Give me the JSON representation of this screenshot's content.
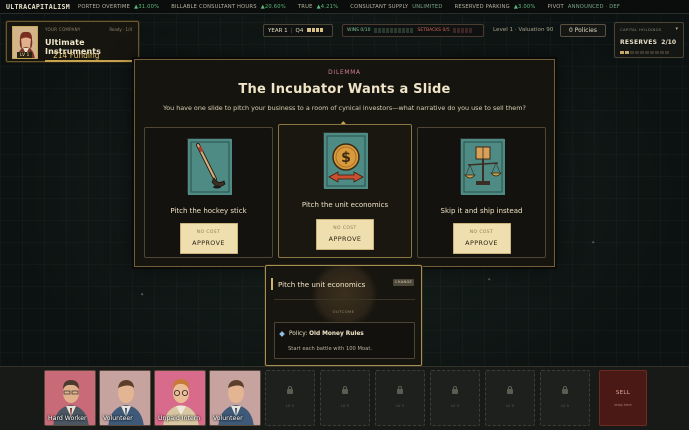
{
  "ticker": {
    "brand": "ULTRACAPITALISM",
    "items": [
      {
        "label": "PORTED OVERTIME",
        "arrow": "▲",
        "change": "31.00%"
      },
      {
        "label": "BILLABLE CONSULTANT HOURS",
        "arrow": "▲",
        "change": "20.60%"
      },
      {
        "label": "TRUE",
        "arrow": "▲",
        "change": "4.21%"
      },
      {
        "label": "CONSULTANT SUPPLY",
        "arrow": "",
        "change": "UNLIMITED"
      },
      {
        "label": "RESERVED PARKING",
        "arrow": "▲",
        "change": "3.00%"
      },
      {
        "label": "PIVOT",
        "arrow": "",
        "change": "ANNOUNCED · DEF"
      }
    ]
  },
  "company": {
    "tag": "YOUR COMPANY",
    "ready": "Ready · 1/4",
    "name": "Ultimate Instruments",
    "funding": "214 Funding",
    "level": "LV 1"
  },
  "status": {
    "year": "YEAR 1",
    "quarter": "Q4",
    "wins_label": "WINS 0/10",
    "setbacks_label": "SETBACKS 0/5",
    "level_text": "Level 1 · Valuation 90",
    "policies_button": "0 Policies",
    "capital_title": "CAPITAL HOLDINGS",
    "reserves_label": "RESERVES",
    "reserves_value": "2/10"
  },
  "dilemma": {
    "kicker": "DILEMMA",
    "title": "The Incubator Wants a Slide",
    "prompt": "You have one slide to pitch your business to a room of cynical investors—what narrative do you use to sell them?",
    "options": [
      {
        "label": "Pitch the hockey stick",
        "cost": "NO COST",
        "button": "APPROVE",
        "icon": "hockey-stick-icon"
      },
      {
        "label": "Pitch the unit economics",
        "cost": "NO COST",
        "button": "APPROVE",
        "icon": "dollar-coin-icon"
      },
      {
        "label": "Skip it and ship instead",
        "cost": "NO COST",
        "button": "APPROVE",
        "icon": "box-on-scale-icon"
      }
    ]
  },
  "preview": {
    "title": "Pitch the unit economics",
    "change_button": "CHANGE",
    "outcome_label": "OUTCOME",
    "policy_prefix": "Policy:",
    "policy_name": "Old Money Rules",
    "description": "Start each battle with 100 Moat."
  },
  "hand": {
    "cards": [
      {
        "label": "Hard Worker",
        "bg": "#c96a78"
      },
      {
        "label": "Volunteer",
        "bg": "#c49a9a"
      },
      {
        "label": "Unpaid Intern",
        "bg": "#d0608a"
      },
      {
        "label": "Volunteer",
        "bg": "#c49a9a"
      }
    ],
    "slot_label": "LV 3",
    "sell_label": "SELL",
    "sell_sub": "drag here"
  }
}
